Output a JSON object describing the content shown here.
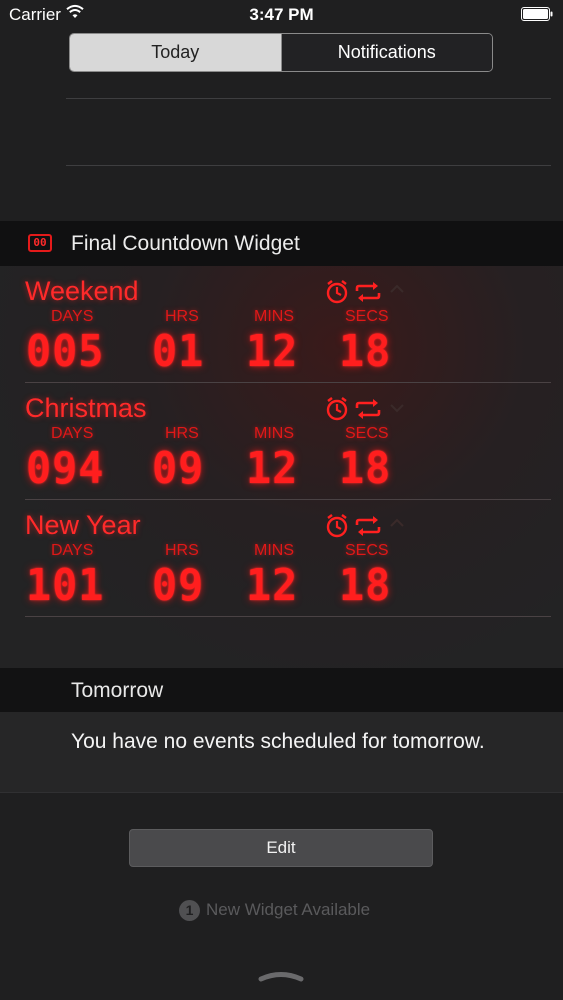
{
  "status_bar": {
    "carrier": "Carrier",
    "time": "3:47 PM"
  },
  "tabs": [
    {
      "label": "Today",
      "active": true
    },
    {
      "label": "Notifications",
      "active": false
    }
  ],
  "widget": {
    "icon_text": "00",
    "title": "Final Countdown Widget",
    "accent_color": "#ff1e1e",
    "unit_labels": [
      "DAYS",
      "HRS",
      "MINS",
      "SECS"
    ],
    "countdowns": [
      {
        "name": "Weekend",
        "days": "005",
        "hrs": "01",
        "mins": "12",
        "secs": "18"
      },
      {
        "name": "Christmas",
        "days": "094",
        "hrs": "09",
        "mins": "12",
        "secs": "18"
      },
      {
        "name": "New Year",
        "days": "101",
        "hrs": "09",
        "mins": "12",
        "secs": "18"
      }
    ],
    "row_icons": [
      "alarm-clock-icon",
      "repeat-icon",
      "chevron-icon"
    ]
  },
  "tomorrow": {
    "title": "Tomorrow",
    "message": "You have no events scheduled for tomorrow."
  },
  "edit_label": "Edit",
  "new_widget": {
    "count": "1",
    "label": "New Widget Available"
  }
}
